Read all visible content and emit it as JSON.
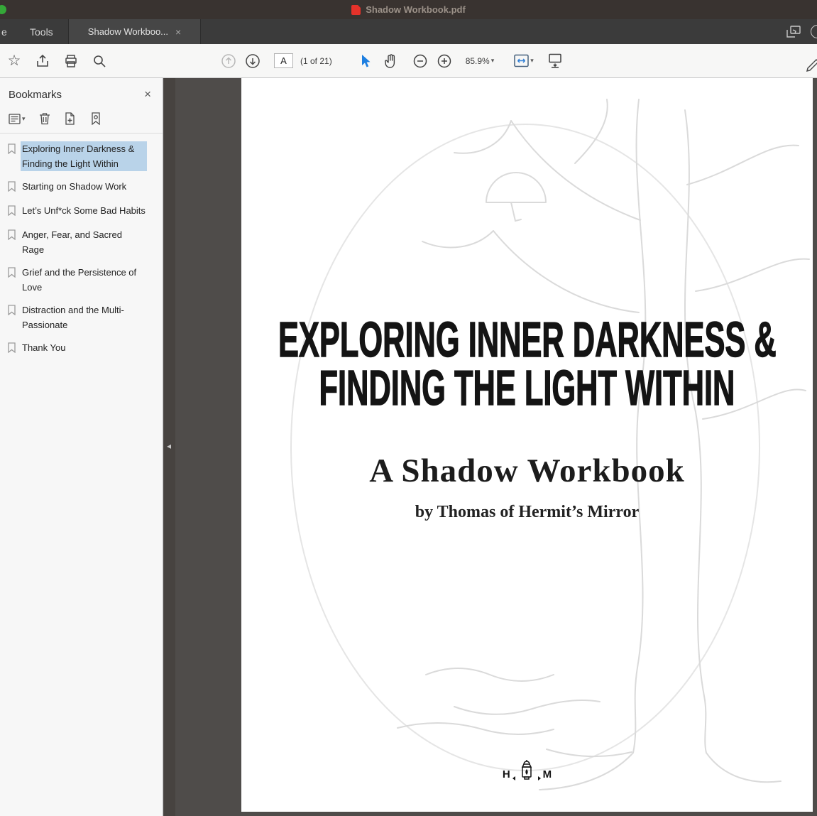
{
  "titlebar": {
    "filename": "Shadow Workbook.pdf"
  },
  "tabbar": {
    "home_partial": "e",
    "tools_label": "Tools",
    "document_tab_label": "Shadow Workboo...",
    "close_tab_glyph": "×"
  },
  "toolbar": {
    "page_input_value": "A",
    "page_count_label": "(1 of 21)",
    "zoom_value": "85.9%"
  },
  "sidebar": {
    "title": "Bookmarks",
    "close_glyph": "×",
    "bookmarks": [
      {
        "label": "Exploring Inner Darkness & Finding the Light Within",
        "selected": true
      },
      {
        "label": "Starting on Shadow Work",
        "selected": false
      },
      {
        "label": "Let’s Unf*ck Some Bad Habits",
        "selected": false
      },
      {
        "label": "Anger, Fear, and Sacred Rage",
        "selected": false
      },
      {
        "label": "Grief and the Persistence of Love",
        "selected": false
      },
      {
        "label": "Distraction and the Multi-Passionate",
        "selected": false
      },
      {
        "label": "Thank You",
        "selected": false
      }
    ]
  },
  "page": {
    "title_line1": "EXPLORING INNER DARKNESS &",
    "title_line2": "FINDING THE LIGHT WITHIN",
    "subtitle": "A Shadow Workbook",
    "byline": "by Thomas of Hermit’s Mirror",
    "logo_left": "H",
    "logo_right": "M"
  },
  "glyphs": {
    "star": "☆",
    "caret_down": "▾",
    "collapse_left": "◂"
  },
  "colors": {
    "accent_blue": "#1e7fe0",
    "selection_highlight": "#b9d3e9",
    "pdf_red": "#e5322a",
    "canvas_gray": "#4f4c4a"
  },
  "icon_names": [
    "pdf-file-icon",
    "star-icon",
    "share-icon",
    "print-icon",
    "search-icon",
    "previous-page-icon",
    "next-page-icon",
    "select-tool-icon",
    "hand-tool-icon",
    "zoom-out-icon",
    "zoom-in-icon",
    "page-display-icon",
    "scroll-mode-icon",
    "sign-icon",
    "popout-window-icon",
    "account-icon",
    "options-icon",
    "trash-icon",
    "new-bookmark-icon",
    "locate-bookmark-icon",
    "bookmark-icon",
    "lantern-icon",
    "close-icon"
  ]
}
